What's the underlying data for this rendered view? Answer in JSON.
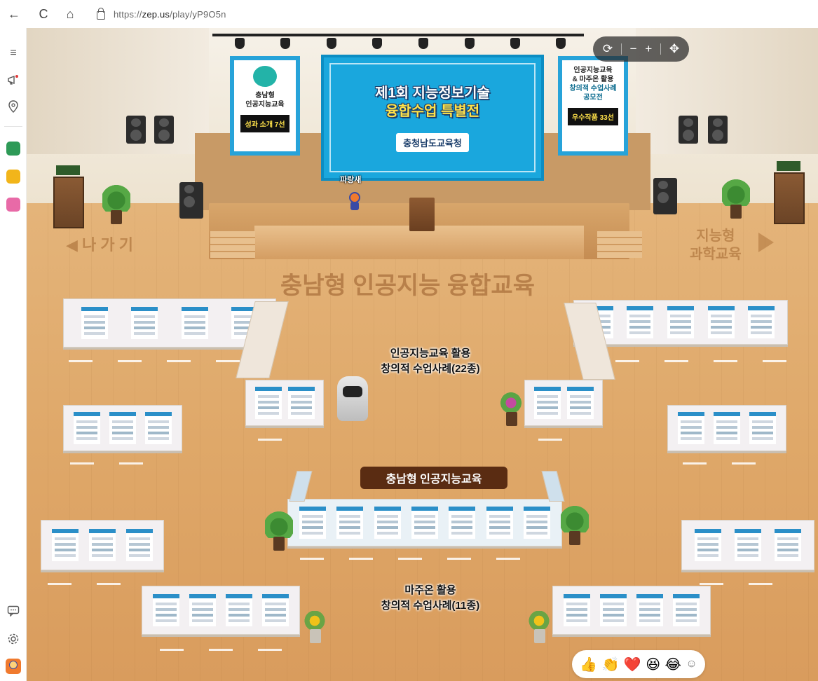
{
  "browser": {
    "back_icon": "←",
    "reload_icon": "C",
    "home_icon": "⌂",
    "url_prefix": "https://",
    "url_host": "zep.us",
    "url_path": "/play/yP9O5n"
  },
  "sidebar": {
    "menu_icon": "≡",
    "megaphone_icon": "megaphone",
    "location_icon": "map-pin",
    "chat_icon": "chat",
    "settings_icon": "gear",
    "apps": [
      {
        "name": "app-tile-green",
        "color": "#2e9a57"
      },
      {
        "name": "app-tile-yellow",
        "color": "#f2b51a"
      },
      {
        "name": "app-tile-pink",
        "color": "#e86aa7"
      }
    ],
    "avatar_color": "#f07a2e"
  },
  "scene": {
    "main_screen": {
      "title_line1": "제1회 지능정보기술",
      "title_line2": "융합수업 특별전",
      "org": "충청남도교육청"
    },
    "poster_left": {
      "line1": "충남형",
      "line2": "인공지능교육",
      "tag": "성과 소개 7선"
    },
    "poster_right": {
      "line1": "인공지능교육",
      "line2": "& 마주온 활용",
      "line3": "창의적 수업사례",
      "line4": "공모전",
      "tag": "우수작품 33선"
    },
    "exit_left": "◀ 나 가 기",
    "exit_right_line1": "지능형",
    "exit_right_line2": "과학교육",
    "floor_title": "충남형 인공지능 융합교육",
    "avatar_name": "파랑새",
    "zone_top_line1": "인공지능교육 활용",
    "zone_top_line2": "창의적 수업사례(22종)",
    "banner": "충남형 인공지능교육",
    "zone_bottom_line1": "마주온 활용",
    "zone_bottom_line2": "창의적 수업사례(11종)"
  },
  "zoom": {
    "rotate": "⟳",
    "minus": "−",
    "plus": "+",
    "move": "✥"
  },
  "reactions": [
    {
      "name": "thumbs-up-reaction",
      "glyph": "👍"
    },
    {
      "name": "clap-reaction",
      "glyph": "👏"
    },
    {
      "name": "heart-reaction",
      "glyph": "❤️"
    },
    {
      "name": "laugh-reaction",
      "glyph": "😆"
    },
    {
      "name": "tears-joy-reaction",
      "glyph": "😂"
    },
    {
      "name": "add-emoji-reaction",
      "glyph": "☺"
    }
  ]
}
